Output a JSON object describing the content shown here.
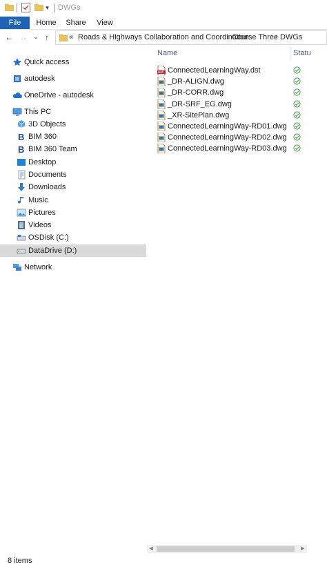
{
  "window": {
    "title": "DWGs"
  },
  "ribbon": {
    "tabs": [
      {
        "label": "File"
      },
      {
        "label": "Home"
      },
      {
        "label": "Share"
      },
      {
        "label": "View"
      }
    ]
  },
  "address": {
    "overflow": "«",
    "crumbs": [
      {
        "label": "Roads & Highways Collaboration and Coordination"
      },
      {
        "label": "Course Three"
      },
      {
        "label": "DWGs"
      }
    ]
  },
  "nav": {
    "quick_access": "Quick access",
    "autodesk": "autodesk",
    "onedrive": "OneDrive - autodesk",
    "this_pc": "This PC",
    "items": [
      {
        "label": "3D Objects"
      },
      {
        "label": "BIM 360"
      },
      {
        "label": "BIM 360 Team"
      },
      {
        "label": "Desktop"
      },
      {
        "label": "Documents"
      },
      {
        "label": "Downloads"
      },
      {
        "label": "Music"
      },
      {
        "label": "Pictures"
      },
      {
        "label": "Videos"
      },
      {
        "label": "OSDisk (C:)"
      },
      {
        "label": "DataDrive (D:)"
      }
    ],
    "network": "Network",
    "selected": "DataDrive (D:)"
  },
  "columns": {
    "name": "Name",
    "status": "Statu"
  },
  "files": [
    {
      "name": "ConnectedLearningWay.dst",
      "type": "dst-icon"
    },
    {
      "name": "_DR-ALIGN.dwg",
      "type": "dwg-icon"
    },
    {
      "name": "_DR-CORR.dwg",
      "type": "dwg-icon"
    },
    {
      "name": "_DR-SRF_EG.dwg",
      "type": "dwg-icon"
    },
    {
      "name": "_XR-SitePlan.dwg",
      "type": "dwg-icon"
    },
    {
      "name": "ConnectedLearningWay-RD01.dwg",
      "type": "dwg-icon"
    },
    {
      "name": "ConnectedLearningWay-RD02.dwg",
      "type": "dwg-icon"
    },
    {
      "name": "ConnectedLearningWay-RD03.dwg",
      "type": "dwg-icon"
    }
  ],
  "status_bar": {
    "item_count": "8 items"
  },
  "colors": {
    "file_tab": "#1f63b6",
    "selection": "#d9d9d9",
    "status_ok": "#3aa33a",
    "folder": "#e8c45a"
  }
}
